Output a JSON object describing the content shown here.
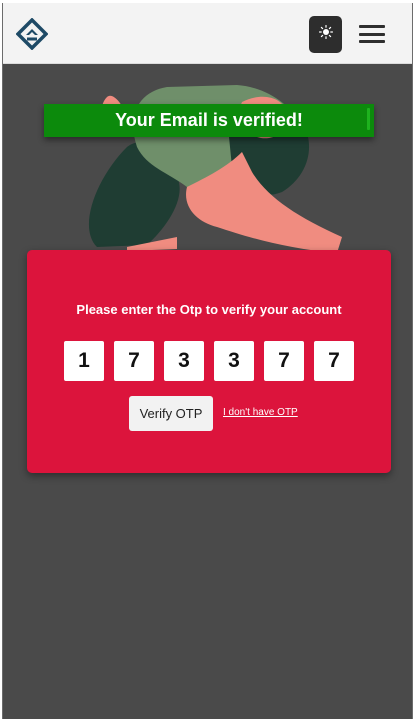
{
  "navbar": {
    "logo_icon": "diamond-arrow-logo-icon",
    "theme_toggle_icon": "sun-icon",
    "menu_icon": "hamburger-menu-icon"
  },
  "banner": {
    "message": "Your Email is verified!",
    "color": "#0c8a0c"
  },
  "otp": {
    "prompt": "Please enter the Otp to verify your account",
    "digits": [
      "1",
      "7",
      "3",
      "3",
      "7",
      "7"
    ],
    "verify_label": "Verify OTP",
    "no_otp_link": "I don't have OTP",
    "card_color": "#dc143c"
  },
  "page": {
    "background": "#4a4a4a"
  }
}
